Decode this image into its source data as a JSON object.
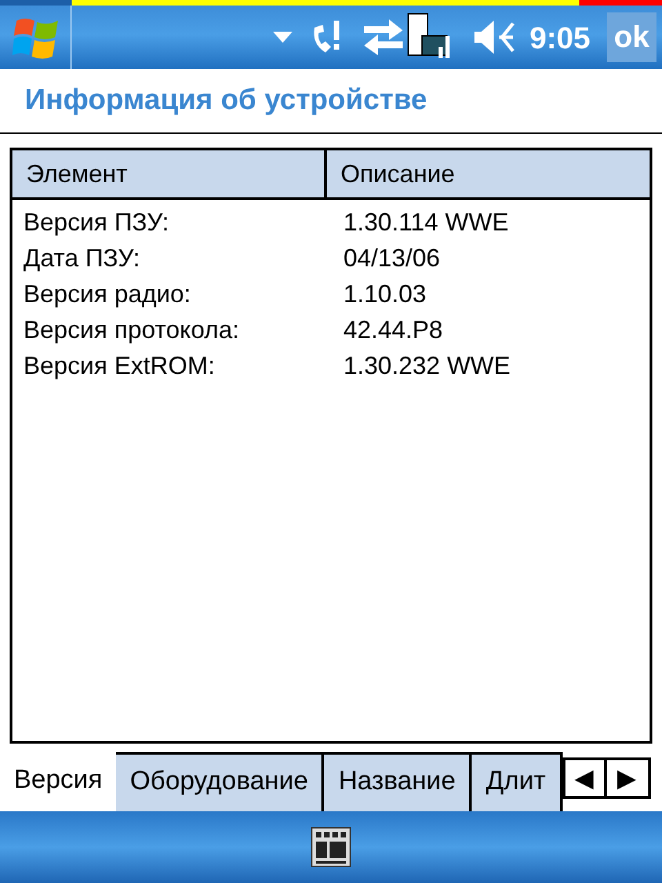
{
  "status_bar": {
    "time": "9:05",
    "ok_button": "ok"
  },
  "title": "Информация об устройстве",
  "table": {
    "columns": [
      "Элемент",
      "Описание"
    ],
    "rows": [
      [
        "Версия ПЗУ:",
        "1.30.114 WWE"
      ],
      [
        "Дата ПЗУ:",
        "04/13/06"
      ],
      [
        "Версия радио:",
        "1.10.03"
      ],
      [
        "Версия протокола:",
        "42.44.P8"
      ],
      [
        "Версия ExtROM:",
        "1.30.232 WWE"
      ]
    ]
  },
  "tabs": [
    {
      "label": "Версия",
      "selected": true
    },
    {
      "label": "Оборудование",
      "selected": false
    },
    {
      "label": "Название",
      "selected": false
    },
    {
      "label": "Длит",
      "selected": false
    }
  ],
  "tab_scroll": {
    "left": "◀",
    "right": "▶"
  }
}
